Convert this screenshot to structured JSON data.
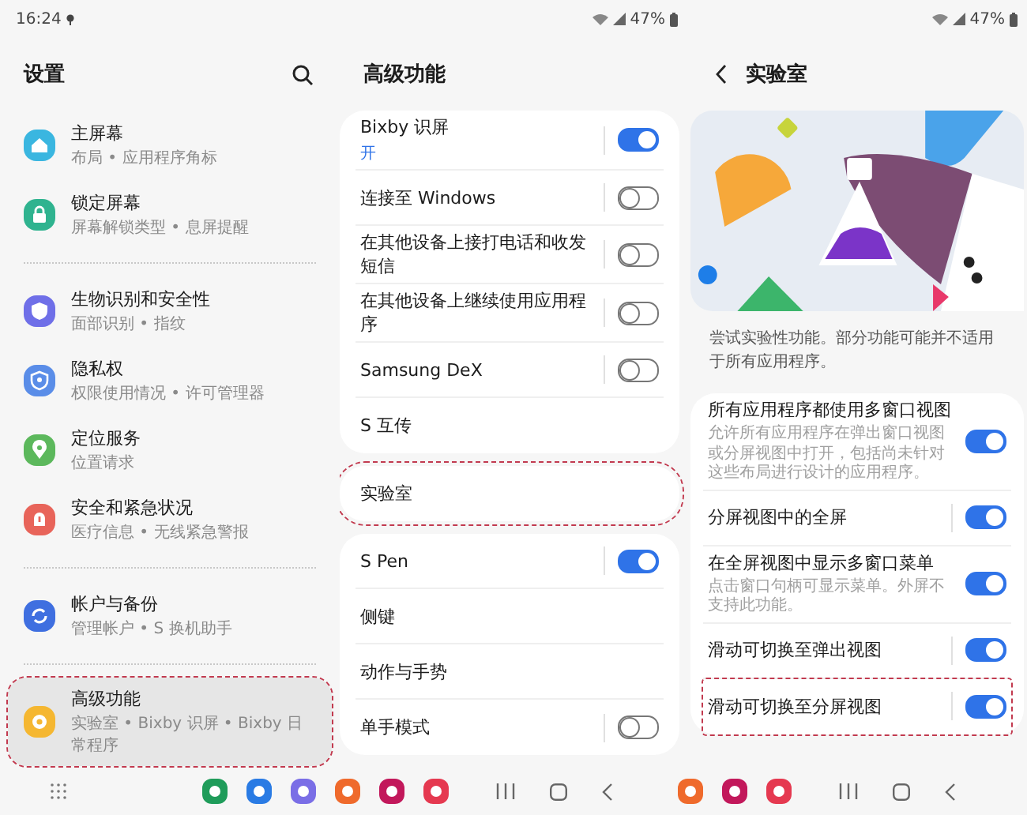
{
  "left_status": {
    "time": "16:24",
    "battery": "47%"
  },
  "right_status": {
    "battery": "47%"
  },
  "settings": {
    "title": "设置",
    "groups": [
      {
        "items": [
          {
            "title": "主屏幕",
            "subtitle": "布局 • 应用程序角标",
            "color": "#3ab6e0",
            "selected": false,
            "highlighted": false
          },
          {
            "title": "锁定屏幕",
            "subtitle": "屏幕解锁类型 • 息屏提醒",
            "color": "#2fb38f",
            "selected": false,
            "highlighted": false
          }
        ]
      },
      {
        "items": [
          {
            "title": "生物识别和安全性",
            "subtitle": "面部识别 • 指纹",
            "color": "#6f6fe8",
            "selected": false,
            "highlighted": false
          },
          {
            "title": "隐私权",
            "subtitle": "权限使用情况 • 许可管理器",
            "color": "#5a8de8",
            "selected": false,
            "highlighted": false
          },
          {
            "title": "定位服务",
            "subtitle": "位置请求",
            "color": "#5cb85c",
            "selected": false,
            "highlighted": false
          },
          {
            "title": "安全和紧急状况",
            "subtitle": "医疗信息 • 无线紧急警报",
            "color": "#e8645a",
            "selected": false,
            "highlighted": false
          }
        ]
      },
      {
        "items": [
          {
            "title": "帐户与备份",
            "subtitle": "管理帐户 • S 换机助手",
            "color": "#3f6fe0",
            "selected": false,
            "highlighted": false
          }
        ]
      },
      {
        "items": [
          {
            "title": "高级功能",
            "subtitle": "实验室 • Bixby 识屏 • Bixby 日常程序",
            "color": "#f5b731",
            "selected": true,
            "highlighted": true
          }
        ]
      }
    ]
  },
  "advanced": {
    "title": "高级功能",
    "cards": [
      {
        "highlighted": false,
        "items": [
          {
            "kind": "toggle",
            "label": "Bixby 识屏",
            "status": "开",
            "on": true
          },
          {
            "kind": "toggle",
            "label": "连接至 Windows",
            "on": false
          },
          {
            "kind": "toggle",
            "label": "在其他设备上接打电话和收发短信",
            "on": false
          },
          {
            "kind": "toggle",
            "label": "在其他设备上继续使用应用程序",
            "on": false
          },
          {
            "kind": "toggle",
            "label": "Samsung DeX",
            "on": false
          },
          {
            "kind": "link",
            "label": "S 互传"
          }
        ]
      },
      {
        "highlighted": true,
        "items": [
          {
            "kind": "link",
            "label": "实验室"
          }
        ]
      },
      {
        "highlighted": false,
        "items": [
          {
            "kind": "toggle",
            "label": "S Pen",
            "on": true
          },
          {
            "kind": "link",
            "label": "侧键"
          },
          {
            "kind": "link",
            "label": "动作与手势"
          },
          {
            "kind": "toggle",
            "label": "单手模式",
            "on": false
          }
        ]
      }
    ]
  },
  "labs": {
    "title": "实验室",
    "description": "尝试实验性功能。部分功能可能并不适用于所有应用程序。",
    "items": [
      {
        "label": "所有应用程序都使用多窗口视图",
        "description": "允许所有应用程序在弹出窗口视图或分屏视图中打开，包括尚未针对这些布局进行设计的应用程序。",
        "on": true,
        "highlighted": false
      },
      {
        "label": "分屏视图中的全屏",
        "on": true,
        "highlighted": false
      },
      {
        "label": "在全屏视图中显示多窗口菜单",
        "description": "点击窗口句柄可显示菜单。外屏不支持此功能。",
        "on": true,
        "highlighted": false
      },
      {
        "label": "滑动可切换至弹出视图",
        "on": true,
        "highlighted": false
      },
      {
        "label": "滑动可切换至分屏视图",
        "on": true,
        "highlighted": true
      }
    ]
  }
}
